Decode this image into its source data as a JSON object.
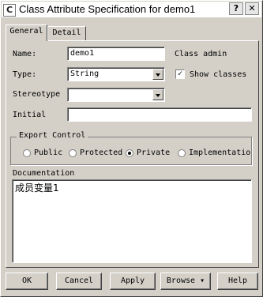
{
  "window": {
    "title": "Class Attribute Specification for demo1",
    "icon": "class-spec-icon"
  },
  "titlebar_buttons": {
    "help": "?",
    "close": "✕"
  },
  "tabs": [
    {
      "label": "General"
    },
    {
      "label": "Detail"
    }
  ],
  "form": {
    "name_label": "Name:",
    "name_value": "demo1",
    "class_caption": "Class admin",
    "type_label": "Type:",
    "type_value": "String",
    "show_classes_label": "Show classes",
    "show_classes_checked": true,
    "stereotype_label": "Stereotype",
    "stereotype_value": "",
    "initial_label": "Initial",
    "initial_value": ""
  },
  "export_control": {
    "title": "Export Control",
    "options": [
      "Public",
      "Protected",
      "Private",
      "Implementation"
    ],
    "selected": "Private"
  },
  "documentation": {
    "label": "Documentation",
    "text": "成员变量1"
  },
  "buttons": {
    "ok": "OK",
    "cancel": "Cancel",
    "apply": "Apply",
    "browse": "Browse",
    "help": "Help"
  }
}
